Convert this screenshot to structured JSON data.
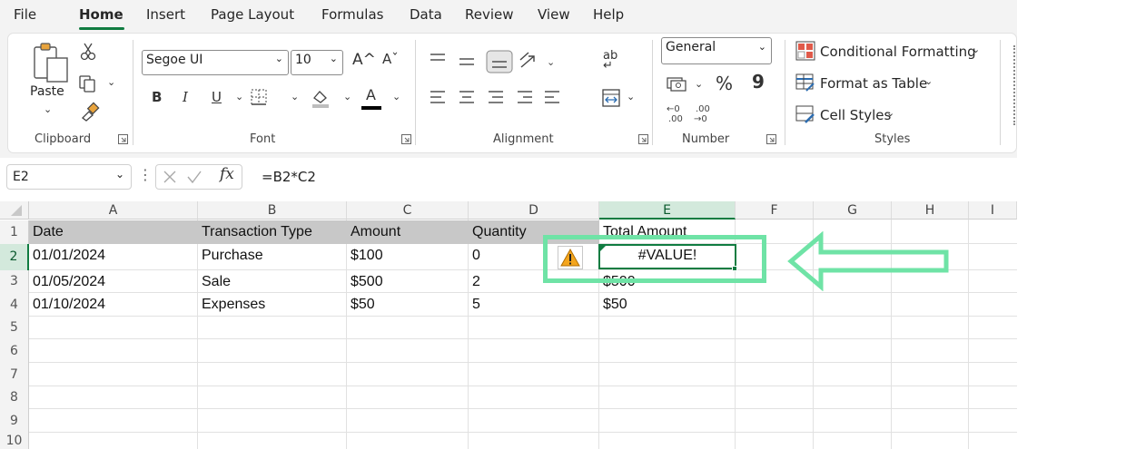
{
  "menu": {
    "tabs": [
      "File",
      "Home",
      "Insert",
      "Page Layout",
      "Formulas",
      "Data",
      "Review",
      "View",
      "Help"
    ],
    "active": "Home"
  },
  "ribbon": {
    "clipboard": {
      "paste_label": "Paste",
      "group_label": "Clipboard"
    },
    "font": {
      "font_name": "Segoe UI",
      "font_size": "10",
      "group_label": "Font",
      "bold": "B",
      "italic": "I",
      "underline": "U",
      "grow": "A^",
      "shrink": "Aˇ",
      "font_color_glyph": "A"
    },
    "alignment": {
      "group_label": "Alignment"
    },
    "number": {
      "format": "General",
      "percent": "%",
      "comma": "9",
      "group_label": "Number"
    },
    "styles": {
      "conditional_formatting": "Conditional Formatting",
      "format_as_table": "Format as Table",
      "cell_styles": "Cell Styles",
      "group_label": "Styles"
    }
  },
  "formula_bar": {
    "name_box": "E2",
    "fx": "fx",
    "formula": "=B2*C2"
  },
  "sheet": {
    "columns": [
      "A",
      "B",
      "C",
      "D",
      "E",
      "F",
      "G",
      "H",
      "I"
    ],
    "rows": [
      "1",
      "2",
      "3",
      "4",
      "5",
      "6",
      "7",
      "8",
      "9",
      "10"
    ],
    "selected_column": "E",
    "selected_row": "2",
    "header_row": [
      "Date",
      "Transaction Type",
      "Amount",
      "Quantity",
      "Total Amount"
    ],
    "data_rows": [
      [
        "01/01/2024",
        "Purchase",
        "$100",
        "0",
        "#VALUE!"
      ],
      [
        "01/05/2024",
        "Sale",
        "$500",
        "2",
        "$500"
      ],
      [
        "01/10/2024",
        "Expenses",
        "$50",
        "5",
        "$50"
      ]
    ]
  },
  "annotation": {
    "highlight_color": "#6fe3a6",
    "excel_green": "#107c41",
    "warning_icon": "warning-triangle-icon"
  }
}
